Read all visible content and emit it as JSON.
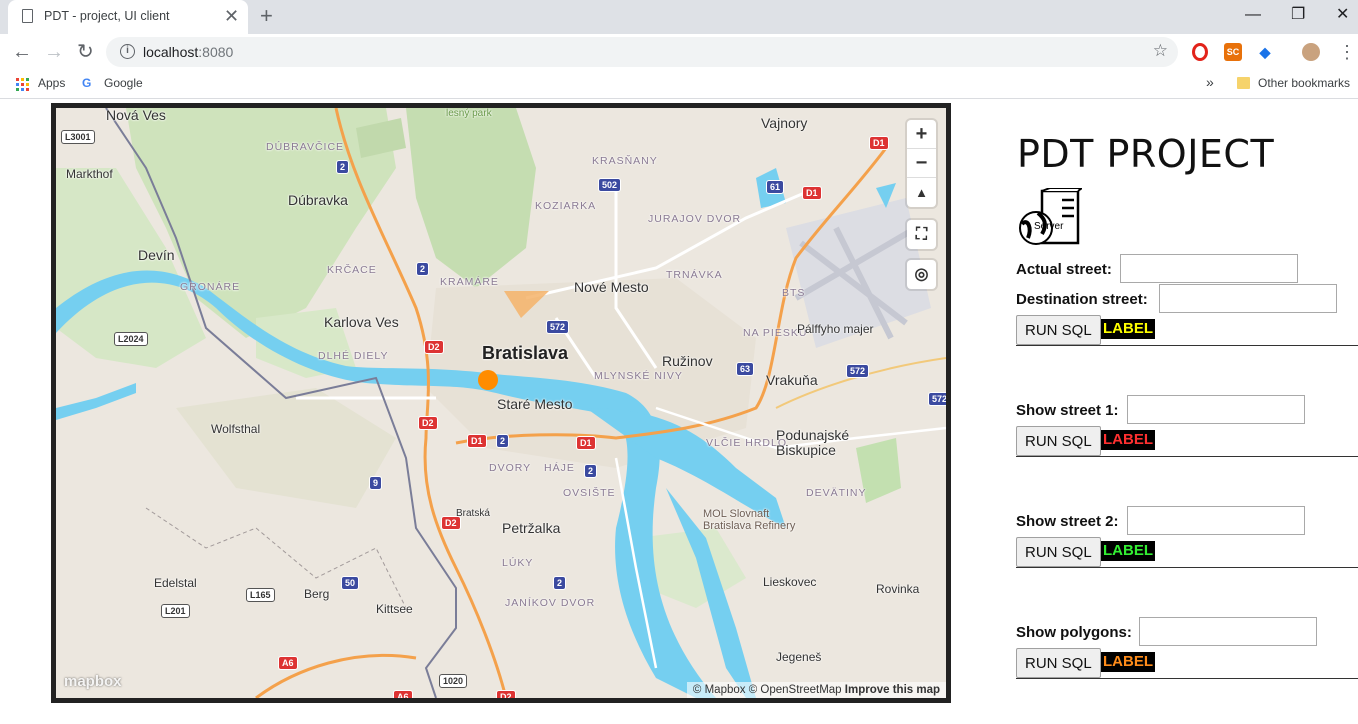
{
  "browser": {
    "tab_title": "PDT - project, UI client",
    "url_host": "localhost",
    "url_port": ":8080",
    "bookmarks": {
      "apps": "Apps",
      "google": "Google",
      "other": "Other bookmarks"
    }
  },
  "map": {
    "zoom_in": "+",
    "zoom_out": "−",
    "attribution_mapbox": "© Mapbox",
    "attribution_osm": "© OpenStreetMap",
    "improve": "Improve this map",
    "logo": "mapbox",
    "places": [
      {
        "name": "Nová Ves",
        "cls": "town"
      },
      {
        "name": "Vajnory",
        "cls": "town"
      },
      {
        "name": "DÚBRAVČICE",
        "cls": "district"
      },
      {
        "name": "Markthof",
        "cls": "small"
      },
      {
        "name": "Dúbravka",
        "cls": "town"
      },
      {
        "name": "KRASŇANY",
        "cls": "district"
      },
      {
        "name": "KOZIARKA",
        "cls": "district"
      },
      {
        "name": "JURAJOV DVOR",
        "cls": "district"
      },
      {
        "name": "Devín",
        "cls": "town"
      },
      {
        "name": "KRČACE",
        "cls": "district"
      },
      {
        "name": "KRAMÁRE",
        "cls": "district"
      },
      {
        "name": "TRNÁVKA",
        "cls": "district"
      },
      {
        "name": "Nové Mesto",
        "cls": "town"
      },
      {
        "name": "GRONÁRE",
        "cls": "district"
      },
      {
        "name": "BTS",
        "cls": "district"
      },
      {
        "name": "Karlova Ves",
        "cls": "town"
      },
      {
        "name": "NA PIESKU",
        "cls": "district"
      },
      {
        "name": "Pálffyho majer",
        "cls": "small"
      },
      {
        "name": "Bratislava",
        "cls": "city"
      },
      {
        "name": "DLHÉ DIELY",
        "cls": "district"
      },
      {
        "name": "Ružinov",
        "cls": "town"
      },
      {
        "name": "MLYNSKÉ NIVY",
        "cls": "district"
      },
      {
        "name": "Vrakuňa",
        "cls": "town"
      },
      {
        "name": "Staré Mesto",
        "cls": "town"
      },
      {
        "name": "Wolfsthal",
        "cls": "small"
      },
      {
        "name": "VLČIE HRDLO",
        "cls": "district"
      },
      {
        "name": "Podunajské Biskupice",
        "cls": "town"
      },
      {
        "name": "DVORY",
        "cls": "district"
      },
      {
        "name": "HÁJE",
        "cls": "district"
      },
      {
        "name": "OVSIŠTE",
        "cls": "district"
      },
      {
        "name": "DEVÄTINY",
        "cls": "district"
      },
      {
        "name": "MOL Slovnaft Bratislava Refinery",
        "cls": "poi"
      },
      {
        "name": "Petržalka",
        "cls": "town"
      },
      {
        "name": "LÚKY",
        "cls": "district"
      },
      {
        "name": "Edelstal",
        "cls": "small"
      },
      {
        "name": "Berg",
        "cls": "small"
      },
      {
        "name": "Kittsee",
        "cls": "small"
      },
      {
        "name": "Lieskovec",
        "cls": "small"
      },
      {
        "name": "Rovinka",
        "cls": "small"
      },
      {
        "name": "JANÍKOV DVOR",
        "cls": "district"
      },
      {
        "name": "Jegeneš",
        "cls": "small"
      },
      {
        "name": "Bratská",
        "cls": "street"
      },
      {
        "name": "lesný park",
        "cls": "park"
      }
    ],
    "shields": [
      "L3001",
      "2",
      "D1",
      "502",
      "61",
      "D1",
      "2",
      "572",
      "L2024",
      "D2",
      "63",
      "572",
      "572",
      "D2",
      "D1",
      "2",
      "D1",
      "2",
      "9",
      "D2",
      "50",
      "2",
      "L165",
      "L201",
      "A6",
      "1020",
      "A6",
      "D2"
    ]
  },
  "panel": {
    "title": "PDT PROJECT",
    "server_icon_text": "Server",
    "rows": [
      {
        "fields": [
          "Actual street:",
          "Destination street:"
        ],
        "button": "RUN SQL",
        "label": "LABEL",
        "label_color": "#ffff00"
      },
      {
        "fields": [
          "Show street 1:"
        ],
        "button": "RUN SQL",
        "label": "LABEL",
        "label_color": "#ff3030"
      },
      {
        "fields": [
          "Show street 2:"
        ],
        "button": "RUN SQL",
        "label": "LABEL",
        "label_color": "#33ee33"
      },
      {
        "fields": [
          "Show polygons:"
        ],
        "button": "RUN SQL",
        "label": "LABEL",
        "label_color": "#ff8c1a"
      }
    ]
  },
  "colors": {
    "marker": "#ff8c00",
    "polygon": "#f5b36a"
  }
}
